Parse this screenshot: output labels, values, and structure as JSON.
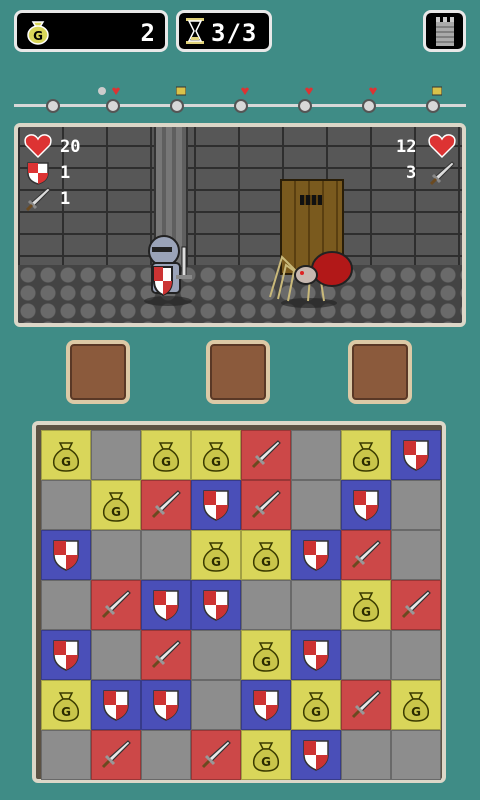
{
  "hud": {
    "gold": "2",
    "turns": "3/3"
  },
  "progress_track": {
    "markers": [
      "skull-heart",
      "chest",
      "heart",
      "heart",
      "heart",
      "chest"
    ]
  },
  "player": {
    "hp": "20",
    "defense": "1",
    "attack": "1"
  },
  "enemy": {
    "hp": "12",
    "attack": "3"
  },
  "colors": {
    "gold": "#d9d65a",
    "sword": "#cc4848",
    "shield": "#4a4fb8",
    "empty": "#8d8d8d",
    "background": "#3f8c86"
  },
  "board": {
    "rows": [
      [
        "gold",
        "empty",
        "gold",
        "gold",
        "sword",
        "empty",
        "gold",
        "shield"
      ],
      [
        "empty",
        "gold",
        "sword",
        "shield",
        "sword",
        "empty",
        "shield",
        "empty"
      ],
      [
        "shield",
        "empty",
        "empty",
        "gold",
        "gold",
        "shield",
        "sword",
        "empty"
      ],
      [
        "empty",
        "sword",
        "shield",
        "shield",
        "empty",
        "empty",
        "gold",
        "sword"
      ],
      [
        "shield",
        "empty",
        "sword",
        "empty",
        "gold",
        "shield",
        "empty",
        "empty"
      ],
      [
        "gold",
        "shield",
        "shield",
        "empty",
        "shield",
        "gold",
        "sword",
        "gold"
      ],
      [
        "empty",
        "sword",
        "empty",
        "sword",
        "gold",
        "shield",
        "empty",
        "empty"
      ]
    ]
  }
}
